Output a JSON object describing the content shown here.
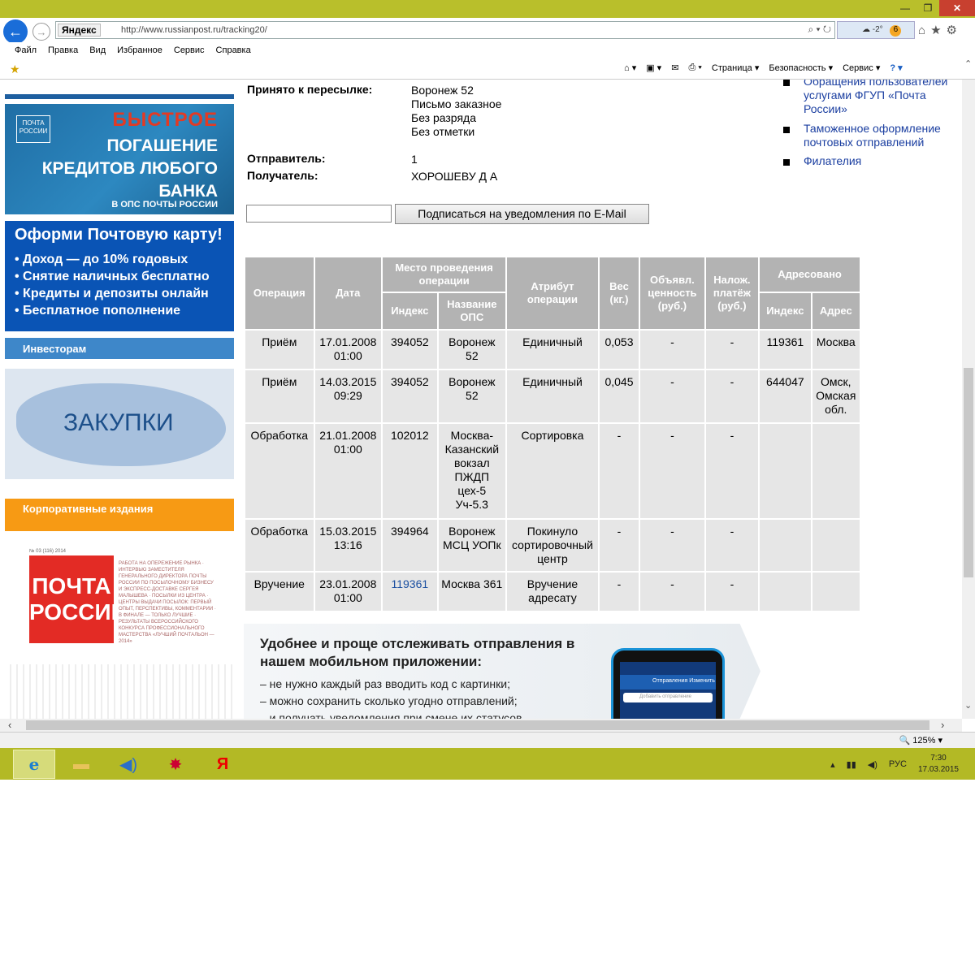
{
  "browser": {
    "back_icon": "back-arrow-icon",
    "forward_icon": "forward-arrow-icon",
    "yandex_label": "Яндекс",
    "url": "http://www.russianpost.ru/tracking20/",
    "search_tools": "⌕ ▾ ↻",
    "weather": "-2°",
    "weather_badge": "6"
  },
  "menu": [
    "Файл",
    "Правка",
    "Вид",
    "Избранное",
    "Сервис",
    "Справка"
  ],
  "command_bar": [
    "Страница ▾",
    "Безопасность ▾",
    "Сервис ▾"
  ],
  "sidebar": {
    "banner1": {
      "logo": "ПОЧТА РОССИИ",
      "line1": "БЫСТРОЕ",
      "line2": "ПОГАШЕНИЕ КРЕДИТОВ ЛЮБОГО БАНКА",
      "line3": "В ОПС ПОЧТЫ РОССИИ"
    },
    "banner2": {
      "title": "Оформи Почтовую карту!",
      "items": [
        "• Доход — до 10% годовых",
        "• Снятие наличных бесплатно",
        "• Кредиты и депозиты онлайн",
        "• Бесплатное пополнение"
      ]
    },
    "investors": "Инвесторам",
    "zakupki": "ЗАКУПКИ",
    "corporate": "Корпоративные издания",
    "magazine": "ПОЧТА РОССИИ",
    "magazine_issue": "№ 03 (116) 2014",
    "magazine_lines": "РАБОТА НА ОПЕРЕЖЕНИЕ РЫНКА · ИНТЕРВЬЮ ЗАМЕСТИТЕЛЯ ГЕНЕРАЛЬНОГО ДИРЕКТОРА ПОЧТЫ РОССИИ ПО ПОСЫЛОЧНОМУ БИЗНЕСУ И ЭКСПРЕСС-ДОСТАВКЕ СЕРГЕЯ МАЛЫШЕВА · ПОСЫЛКИ ИЗ ЦЕНТРА · ЦЕНТРЫ ВЫДАЧИ ПОСЫЛОК: ПЕРВЫЙ ОПЫТ, ПЕРСПЕКТИВЫ, КОММЕНТАРИИ · В ФИНАЛЕ — ТОЛЬКО ЛУЧШИЕ · РЕЗУЛЬТАТЫ ВСЕРОССИЙСКОГО КОНКУРСА ПРОФЕССИОНАЛЬНОГО МАСТЕРСТВА «ЛУЧШИЙ ПОЧТАЛЬОН — 2014»"
  },
  "info": {
    "accepted_label": "Принято к пересылке:",
    "accepted_values": [
      "Воронеж 52",
      "Письмо заказное",
      "Без разряда",
      "Без отметки"
    ],
    "sender_label": "Отправитель:",
    "sender_value": "1",
    "recipient_label": "Получатель:",
    "recipient_value": "ХОРОШЕВУ Д А"
  },
  "subscribe_button": "Подписаться на уведомления по E-Mail",
  "table": {
    "headers": {
      "operation": "Операция",
      "date": "Дата",
      "place": "Место проведения операции",
      "index": "Индекс",
      "ops_name": "Название ОПС",
      "attribute": "Атрибут операции",
      "weight": "Вес (кг.)",
      "declared": "Объявл. ценность (руб.)",
      "cod": "Налож. платёж (руб.)",
      "addressed": "Адресовано",
      "addr_index": "Индекс",
      "address": "Адрес"
    },
    "rows": [
      {
        "op": "Приём",
        "date": "17.01.2008 01:00",
        "index": "394052",
        "ops": "Воронеж 52",
        "attr": "Единичный",
        "weight": "0,053",
        "declared": "-",
        "cod": "-",
        "to_index": "119361",
        "to_addr": "Москва"
      },
      {
        "op": "Приём",
        "date": "14.03.2015 09:29",
        "index": "394052",
        "ops": "Воронеж 52",
        "attr": "Единичный",
        "weight": "0,045",
        "declared": "-",
        "cod": "-",
        "to_index": "644047",
        "to_addr": "Омск, Омская обл."
      },
      {
        "op": "Обработка",
        "date": "21.01.2008 01:00",
        "index": "102012",
        "ops": "Москва-Казанский вокзал ПЖДП цех-5 Уч-5.3",
        "attr": "Сортировка",
        "weight": "-",
        "declared": "-",
        "cod": "-",
        "to_index": "",
        "to_addr": ""
      },
      {
        "op": "Обработка",
        "date": "15.03.2015 13:16",
        "index": "394964",
        "ops": "Воронеж МСЦ УОПк",
        "attr": "Покинуло сортировочный центр",
        "weight": "-",
        "declared": "-",
        "cod": "-",
        "to_index": "",
        "to_addr": ""
      },
      {
        "op": "Вручение",
        "date": "23.01.2008 01:00",
        "index": "119361",
        "ops": "Москва 361",
        "attr": "Вручение адресату",
        "weight": "-",
        "declared": "-",
        "cod": "-",
        "to_index": "",
        "to_addr": ""
      }
    ]
  },
  "promo": {
    "title": "Удобнее и проще отслеживать отправления в нашем мобильном приложении:",
    "items": [
      "– не нужно каждый раз вводить код с картинки;",
      "– можно сохранить сколько угодно отправлений;",
      "– и получать уведомления при смене их статусов"
    ],
    "phone_tab": "Отправления   Изменить",
    "phone_input": "Добавить отправление"
  },
  "right_links": [
    "Обращения пользователей услугами ФГУП «Почта России»",
    "Таможенное оформление почтовых отправлений",
    "Филателия"
  ],
  "status": {
    "zoom": "🔍 125% ▾"
  },
  "tray": {
    "lang": "РУС",
    "time": "7:30",
    "date": "17.03.2015"
  }
}
